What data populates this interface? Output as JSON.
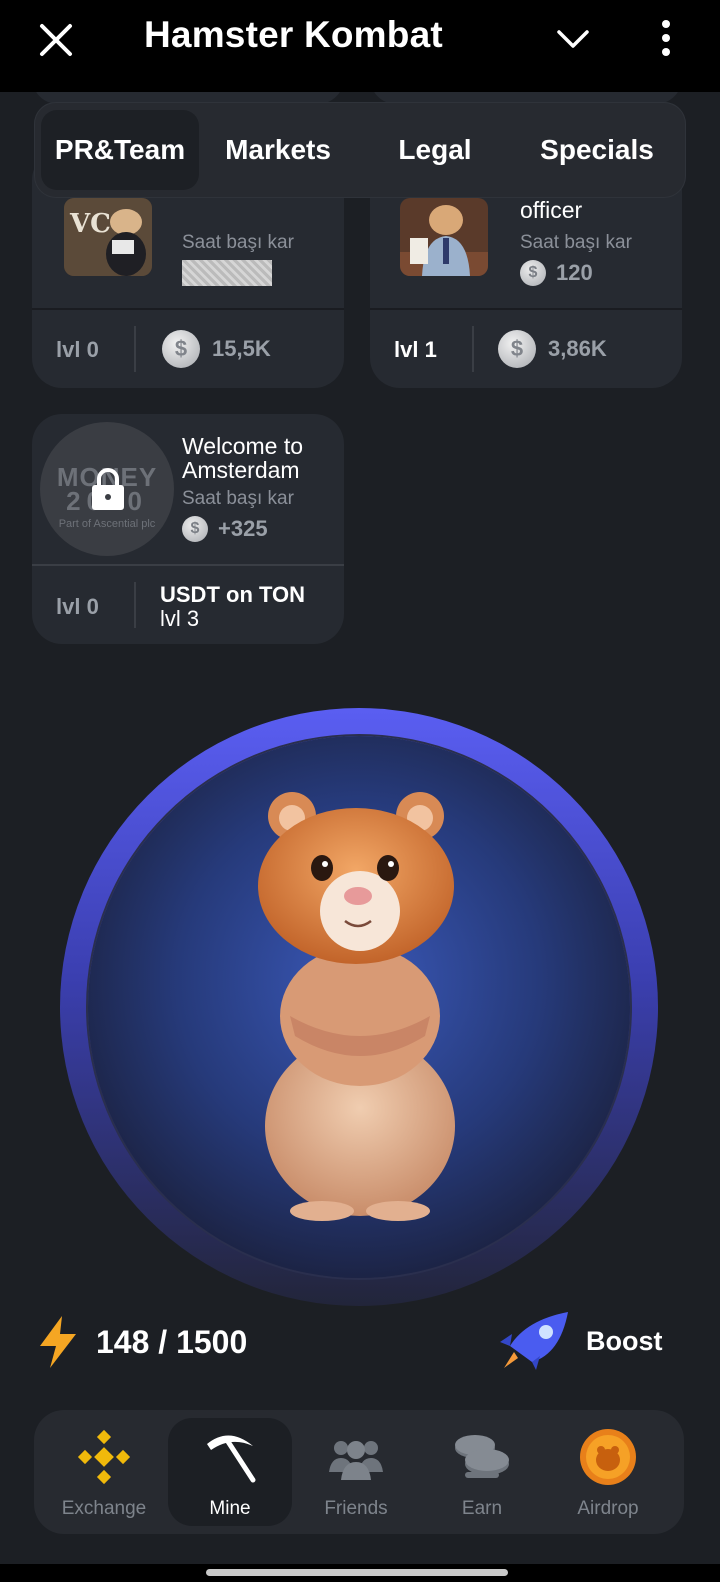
{
  "app": {
    "title": "Hamster Kombat"
  },
  "tabs": [
    {
      "label": "PR&Team",
      "active": true
    },
    {
      "label": "Markets",
      "active": false
    },
    {
      "label": "Legal",
      "active": false
    },
    {
      "label": "Specials",
      "active": false
    }
  ],
  "cards": [
    {
      "name": "",
      "profit_label": "Saat başı kar",
      "profit": "",
      "level": "lvl 0",
      "cost": "15,5K",
      "locked": false
    },
    {
      "name": "officer",
      "profit_label": "Saat başı kar",
      "profit": "120",
      "level": "lvl 1",
      "cost": "3,86K",
      "locked": false
    },
    {
      "name": "Welcome to Amsterdam",
      "logo_text": [
        "MONEY",
        "2020",
        "Part of Ascential plc"
      ],
      "profit_label": "Saat başı kar",
      "profit": "+325",
      "level": "lvl 0",
      "requirement": "USDT on TON",
      "requirement_level": "lvl 3",
      "locked": true
    }
  ],
  "energy": {
    "current": "148",
    "max": "1500",
    "display": "148 / 1500"
  },
  "boost": {
    "label": "Boost"
  },
  "nav": [
    {
      "label": "Exchange",
      "icon": "binance-icon",
      "active": false
    },
    {
      "label": "Mine",
      "icon": "pickaxe-icon",
      "active": true
    },
    {
      "label": "Friends",
      "icon": "friends-icon",
      "active": false
    },
    {
      "label": "Earn",
      "icon": "coins-icon",
      "active": false
    },
    {
      "label": "Airdrop",
      "icon": "airdrop-coin-icon",
      "active": false
    }
  ],
  "colors": {
    "background": "#1c1f24",
    "card": "#262a31",
    "accent_ring": "#5a5ef2",
    "energy": "#f5a623"
  }
}
